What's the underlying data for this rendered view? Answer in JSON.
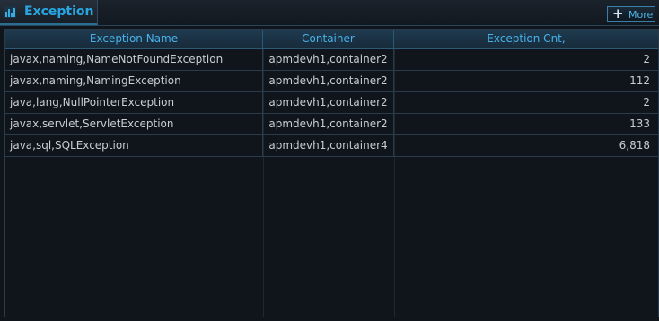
{
  "panel": {
    "title": "Exception",
    "title_icon": "bar-chart-icon",
    "more_label": "More",
    "more_icon": "plus-icon",
    "accent_color": "#27a6e2"
  },
  "table": {
    "columns": [
      "Exception Name",
      "Container",
      "Exception Cnt,"
    ],
    "rows": [
      {
        "name": "javax,naming,NameNotFoundException",
        "container": "apmdevh1,container2",
        "count": "2"
      },
      {
        "name": "javax,naming,NamingException",
        "container": "apmdevh1,container2",
        "count": "112"
      },
      {
        "name": "java,lang,NullPointerException",
        "container": "apmdevh1,container2",
        "count": "2"
      },
      {
        "name": "javax,servlet,ServletException",
        "container": "apmdevh1,container2",
        "count": "133"
      },
      {
        "name": "java,sql,SQLException",
        "container": "apmdevh1,container4",
        "count": "6,818"
      }
    ]
  }
}
